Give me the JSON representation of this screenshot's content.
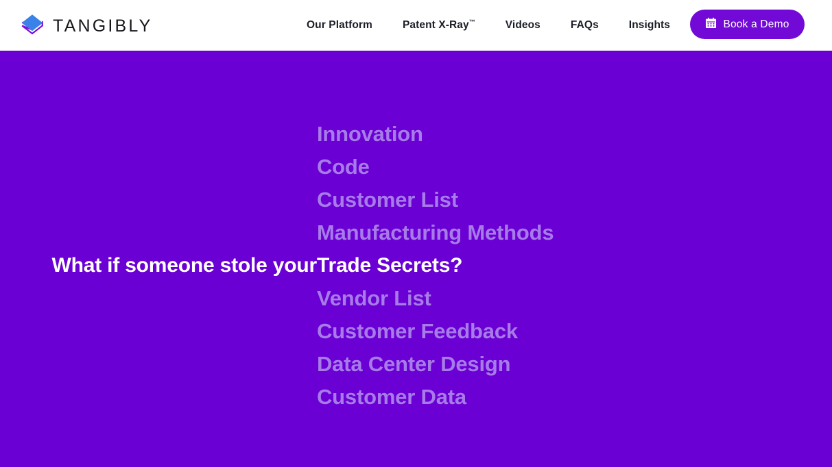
{
  "colors": {
    "hero_background": "#6A00D4",
    "header_background": "#FFFFFF",
    "button_purple": "#7209D6",
    "rotator_text": "#A87CE8",
    "headline_text": "#FFFFFF",
    "nav_text": "#1B1D26",
    "logo_diamond_blue": "#3B82E8",
    "logo_chevron_purple": "#7A0DD6"
  },
  "header": {
    "brand": {
      "wordmark": "TANGIBLY",
      "mark_icon": "diamond-chevron-logo-icon"
    },
    "nav": [
      {
        "label": "Our Platform",
        "trademark": ""
      },
      {
        "label": "Patent X-Ray",
        "trademark": "™"
      },
      {
        "label": "Videos",
        "trademark": ""
      },
      {
        "label": "FAQs",
        "trademark": ""
      },
      {
        "label": "Insights",
        "trademark": ""
      }
    ],
    "cta": {
      "label": "Book a Demo",
      "icon": "calendar-icon"
    }
  },
  "hero": {
    "headline_prefix": "What if someone stole your ",
    "active_term": "Trade Secrets?",
    "rotator_terms": [
      "Innovation",
      "Code",
      "Customer List",
      "Manufacturing Methods",
      "Trade Secrets?",
      "Vendor List",
      "Customer Feedback",
      "Data Center Design",
      "Customer Data"
    ],
    "active_index": 4
  }
}
